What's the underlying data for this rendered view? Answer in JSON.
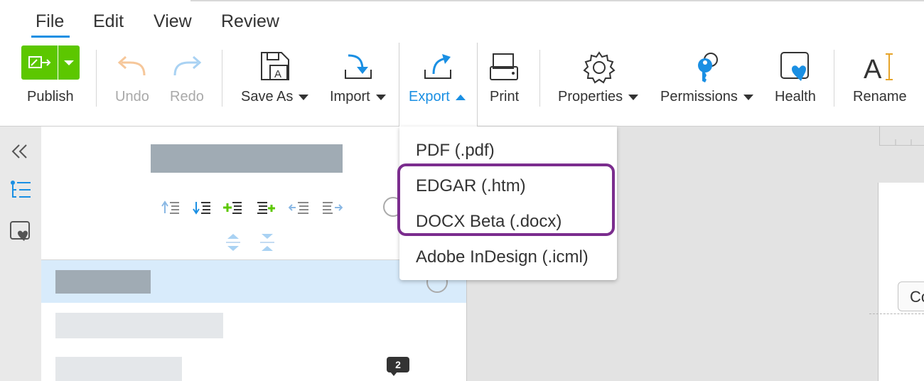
{
  "menubar": {
    "items": [
      "File",
      "Edit",
      "View",
      "Review"
    ],
    "active": "File"
  },
  "ribbon": {
    "publish": "Publish",
    "undo": "Undo",
    "redo": "Redo",
    "save_as": "Save As",
    "import": "Import",
    "export": "Export",
    "print": "Print",
    "properties": "Properties",
    "permissions": "Permissions",
    "health": "Health",
    "rename": "Rename"
  },
  "export_menu": {
    "items": [
      "PDF (.pdf)",
      "EDGAR (.htm)",
      "DOCX Beta (.docx)",
      "Adobe InDesign (.icml)"
    ]
  },
  "outline": {
    "comment_count": "2"
  },
  "document": {
    "partial_button": "Co"
  },
  "colors": {
    "accent": "#1a8fe3",
    "publish_green": "#5cc700",
    "highlight_purple": "#7b2d8e",
    "selected_row": "#d8ebfb"
  }
}
